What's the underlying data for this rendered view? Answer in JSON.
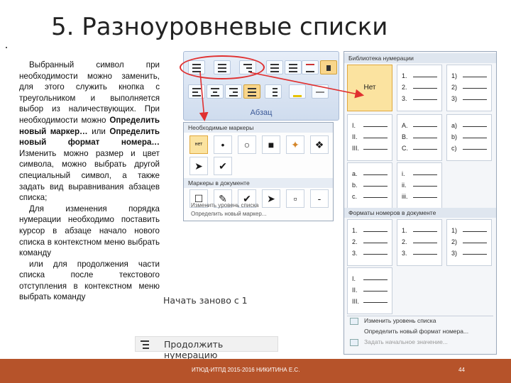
{
  "slide": {
    "title": "5. Разноуровневые списки",
    "body": {
      "p1_a": "Выбранный символ при необходимости можно заменить, для этого служить кнопка с треугольником и выполняется выбор из наличествующих. При необходимости можно ",
      "p1_b1": "Определить новый маркер…",
      "p1_c": " или ",
      "p1_b2": "Определить новый формат номера…",
      "p1_d": " Изменить можно размер и цвет символа, можно выбрать другой специальный символ, а также задать вид выравнивания абзацев списка;",
      "p2": "Для изменения порядка нумерации необходимо поставить курсор в абзаце начало нового списка в контекстном меню выбрать команду",
      "p3": "или для продолжения части списка после текстового отступления в контекстном меню выбрать команду"
    }
  },
  "ribbon": {
    "group_label": "Абзац"
  },
  "bullet_panel": {
    "recent_header": "Необходимые маркеры",
    "library_header": "Маркеры в документе",
    "none_label": "нет",
    "symbols_row1": [
      "•",
      "○",
      "■",
      "✦",
      "❖"
    ],
    "symbols_row2": [
      "➤",
      "✔"
    ],
    "symbols_row3": [
      "☐",
      "✎",
      "✔",
      "➤",
      "▫",
      "-"
    ],
    "link1": "Изменить уровень списка",
    "link2": "Определить новый маркер..."
  },
  "numbering_panel": {
    "library_header": "Библиотека нумерации",
    "doc_header": "Форматы номеров в документе",
    "none_label": "Нет",
    "library": [
      [
        "1.",
        "2.",
        "3."
      ],
      [
        "1)",
        "2)",
        "3)"
      ],
      [
        "I.",
        "II.",
        "III."
      ],
      [
        "A.",
        "B.",
        "C."
      ],
      [
        "a)",
        "b)",
        "c)"
      ],
      [
        "a.",
        "b.",
        "c."
      ],
      [
        "i.",
        "ii.",
        "iii."
      ]
    ],
    "document": [
      [
        "1.",
        "2.",
        "3."
      ],
      [
        "1.",
        "2.",
        "3."
      ],
      [
        "1)",
        "2)",
        "3)"
      ],
      [
        "I.",
        "II.",
        "III."
      ]
    ],
    "link1": "Изменить уровень списка",
    "link2": "Определить новый формат номера...",
    "link3": "Задать начальное значение..."
  },
  "commands": {
    "restart": "Начать заново с 1",
    "continue": "Продолжить нумерацию"
  },
  "footer": {
    "center": "ИТЮД-ИТПД 2015-2016   НИКИТИНА Е.С.",
    "page": "44"
  },
  "colors": {
    "footer_bg": "#b6532a",
    "highlight": "#e03030",
    "selected": "#fbe3a0"
  }
}
